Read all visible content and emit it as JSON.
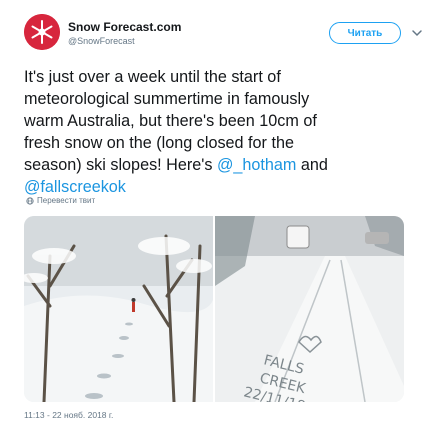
{
  "tweet": {
    "author_name": "Snow Forecast.com",
    "author_handle": "@SnowForecast",
    "follow_label": "Читать",
    "text_plain": "It's just over a week until the start of\nmeteorological summertime in famously\nwarm Australia, but there's been 10cm of\nfresh snow on the (long closed for the\nseason) ski slopes!  Here's ",
    "mention_1": "@_hotham",
    "text_between": " and\n",
    "mention_2": "@fallscreekok",
    "translate_label": "Перевести твит",
    "timestamp": "11:13 - 22 нояб. 2018 г.",
    "snow_writing": "FALLS CREEK 22/11/18"
  },
  "colors": {
    "link": "#1b95e0",
    "follow_border": "#1da1f2",
    "muted": "#657786",
    "avatar": "#d7263d"
  },
  "icons": [
    "avatar-snowflake-icon",
    "chevron-down-icon",
    "globe-icon"
  ]
}
